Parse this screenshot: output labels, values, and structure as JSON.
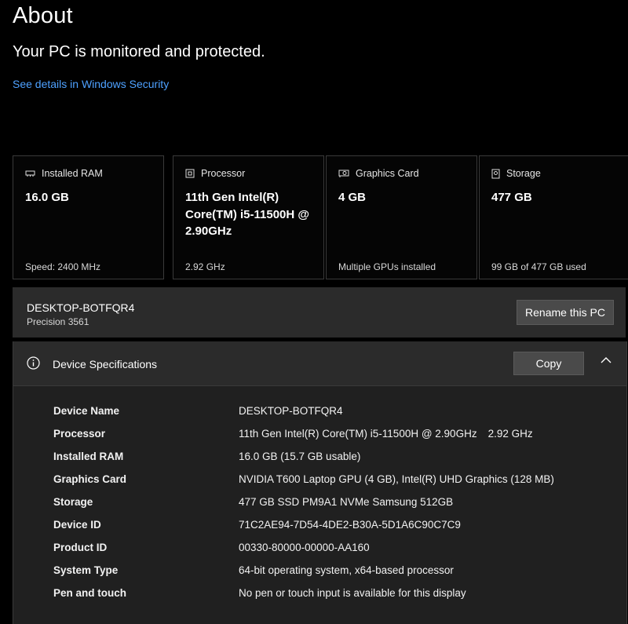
{
  "page": {
    "title": "About",
    "status": "Your PC is monitored and protected.",
    "security_link": "See details in Windows Security"
  },
  "cards": [
    {
      "icon": "ram-icon",
      "label": "Installed RAM",
      "value": "16.0 GB",
      "footer": "Speed: 2400 MHz"
    },
    {
      "icon": "processor-icon",
      "label": "Processor",
      "value": "11th Gen Intel(R) Core(TM) i5-11500H @ 2.90GHz",
      "footer": "2.92 GHz"
    },
    {
      "icon": "graphics-card-icon",
      "label": "Graphics Card",
      "value": "4 GB",
      "footer": "Multiple GPUs installed"
    },
    {
      "icon": "storage-icon",
      "label": "Storage",
      "value": "477 GB",
      "footer": "99 GB of 477 GB used"
    }
  ],
  "pc": {
    "name": "DESKTOP-BOTFQR4",
    "model": "Precision 3561",
    "rename_label": "Rename this PC"
  },
  "specs": {
    "title": "Device Specifications",
    "copy_label": "Copy",
    "rows": [
      {
        "key": "Device Name",
        "value": "DESKTOP-BOTFQR4"
      },
      {
        "key": "Processor",
        "value": "11th Gen Intel(R) Core(TM) i5-11500H @ 2.90GHz",
        "value2": "2.92 GHz"
      },
      {
        "key": "Installed RAM",
        "value": "16.0 GB (15.7 GB usable)"
      },
      {
        "key": "Graphics Card",
        "value": "NVIDIA T600 Laptop GPU (4 GB), Intel(R) UHD Graphics (128 MB)"
      },
      {
        "key": "Storage",
        "value": "477 GB SSD PM9A1 NVMe Samsung 512GB"
      },
      {
        "key": "Device ID",
        "value": "71C2AE94-7D54-4DE2-B30A-5D1A6C90C7C9"
      },
      {
        "key": "Product ID",
        "value": "00330-80000-00000-AA160"
      },
      {
        "key": "System Type",
        "value": "64-bit operating system, x64-based processor"
      },
      {
        "key": "Pen and touch",
        "value": "No pen or touch input is available for this display"
      }
    ]
  },
  "colors": {
    "background": "#000000",
    "link": "#4ea1ff",
    "panel": "#2b2b2b",
    "button": "#4a4a4a"
  }
}
